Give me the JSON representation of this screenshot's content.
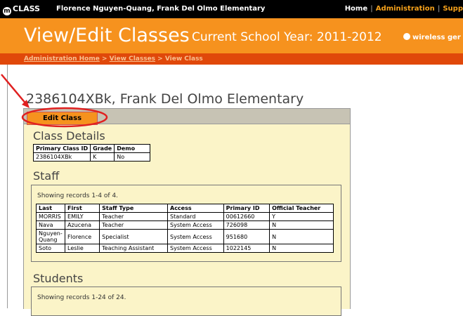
{
  "topbar": {
    "logo": "CLASS",
    "user": "Florence Nguyen-Quang, Frank Del Olmo Elementary",
    "nav": {
      "home": "Home",
      "administration": "Administration",
      "support": "Supp"
    }
  },
  "header": {
    "title": "View/Edit Classes",
    "subtitle": "Current School Year: 2011-2012",
    "brand": "wireless ger"
  },
  "breadcrumb": {
    "items": [
      "Administration Home",
      "View Classes",
      "View Class"
    ],
    "sep": " > "
  },
  "class_title": "2386104XBk, Frank Del Olmo Elementary",
  "edit_button": "Edit Class",
  "class_details": {
    "title": "Class Details",
    "headers": [
      "Primary Class ID",
      "Grade",
      "Demo"
    ],
    "row": [
      "2386104XBk",
      "K",
      "No"
    ]
  },
  "staff": {
    "title": "Staff",
    "showing": "Showing records 1-4 of 4.",
    "headers": [
      "Last",
      "First",
      "Staff Type",
      "Access",
      "Primary ID",
      "Official Teacher"
    ],
    "rows": [
      [
        "MORRIS",
        "EMILY",
        "Teacher",
        "Standard",
        "00612660",
        "Y"
      ],
      [
        "Nava",
        "Azucena",
        "Teacher",
        "System Access",
        "726098",
        "N"
      ],
      [
        "Nguyen-Quang",
        "Florence",
        "Specialist",
        "System Access",
        "951680",
        "N"
      ],
      [
        "Soto",
        "Leslie",
        "Teaching Assistant",
        "System Access",
        "1022145",
        "N"
      ]
    ]
  },
  "students": {
    "title": "Students",
    "showing": "Showing records 1-24 of 24."
  },
  "colors": {
    "accent": "#f6921e",
    "breadcrumb_bg": "#e0480a",
    "panel_bg": "#fbf4c8"
  }
}
